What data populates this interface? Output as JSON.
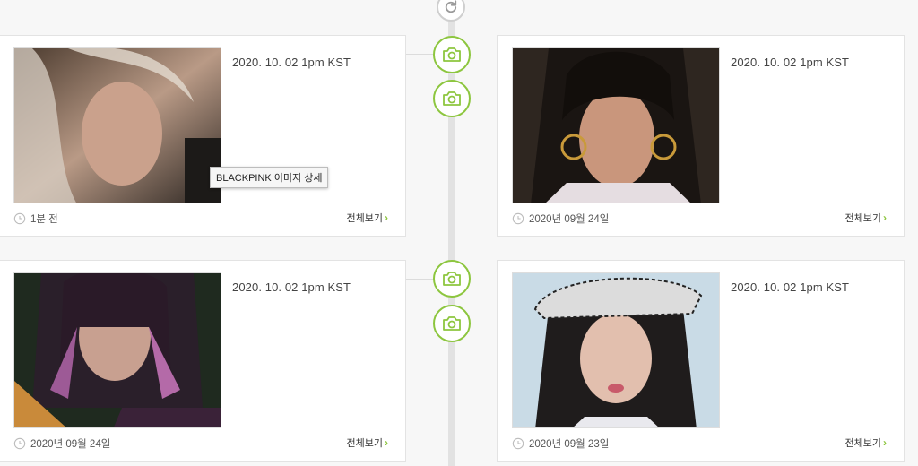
{
  "tooltip": {
    "text": "BLACKPINK 이미지 상세"
  },
  "view_all_label": "전체보기",
  "posts": [
    {
      "broadcast": "2020. 10. 02 1pm KST",
      "time": "1분 전",
      "image": "photo-rose"
    },
    {
      "broadcast": "2020. 10. 02 1pm KST",
      "time": "2020년 09월 24일",
      "image": "photo-jennie-hoops"
    },
    {
      "broadcast": "2020. 10. 02 1pm KST",
      "time": "2020년 09월 24일",
      "image": "photo-lisa"
    },
    {
      "broadcast": "2020. 10. 02 1pm KST",
      "time": "2020년 09월 23일",
      "image": "photo-jennie-beret"
    }
  ],
  "icons": {
    "timeline_node": "camera-icon",
    "top_button": "refresh-icon",
    "time": "clock-icon",
    "view_all": "chevron-right-icon"
  },
  "colors": {
    "accent": "#8dc63f",
    "card_border": "#e3e3e3",
    "timeline": "#e2e2e2",
    "background": "#f7f7f7"
  }
}
